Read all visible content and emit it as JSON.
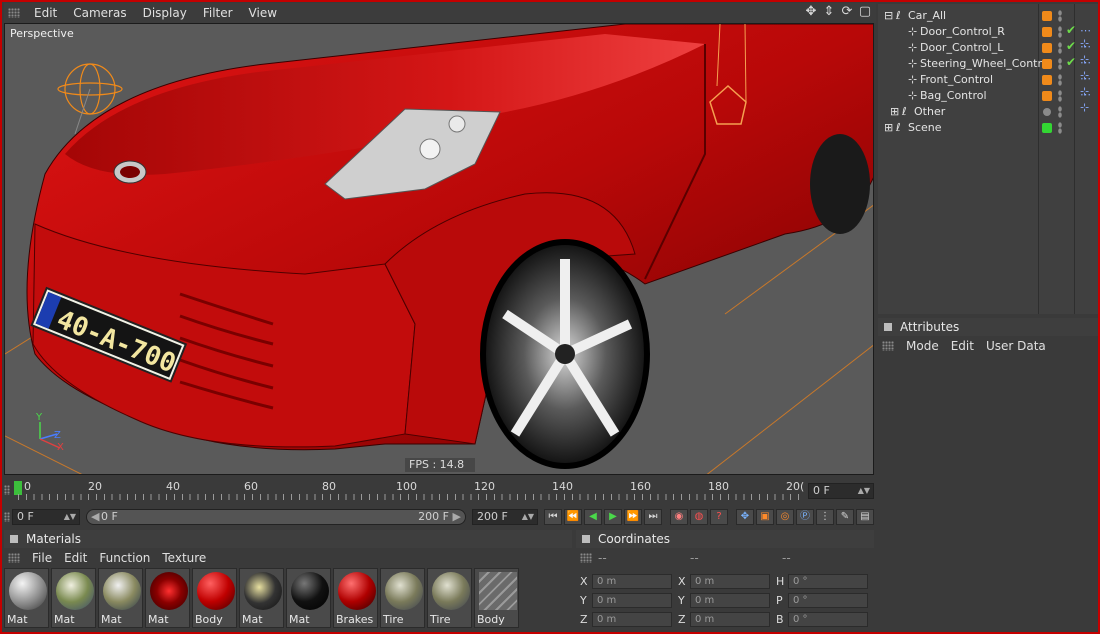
{
  "colors": {
    "accent_red": "#c40000",
    "tag_orange": "#f08a1a",
    "tag_green": "#33d633",
    "car_red": "#c80a0a"
  },
  "viewport": {
    "menu": [
      "Edit",
      "Cameras",
      "Display",
      "Filter",
      "View"
    ],
    "label": "Perspective",
    "fps": "FPS : 14.8",
    "axis_y": "Y",
    "axis_z": "Z",
    "axis_x": "X",
    "plate_text": "40-A-700",
    "plate_small_left": "B\n6",
    "plate_small_right": "3\n7"
  },
  "timeline": {
    "ticks": [
      "0",
      "20",
      "40",
      "60",
      "80",
      "100",
      "120",
      "140",
      "160",
      "180",
      "20("
    ],
    "current_frame": "0 F",
    "start_field": "0 F",
    "range_start": "0 F",
    "range_end": "200 F",
    "end_field": "200 F"
  },
  "materials": {
    "title": "Materials",
    "menu": [
      "File",
      "Edit",
      "Function",
      "Texture"
    ],
    "items": [
      {
        "label": "Mat",
        "style": "grey"
      },
      {
        "label": "Mat",
        "style": "photo"
      },
      {
        "label": "Mat",
        "style": "photo2"
      },
      {
        "label": "Mat",
        "style": "red_swirl"
      },
      {
        "label": "Body",
        "style": "red"
      },
      {
        "label": "Mat",
        "style": "plate"
      },
      {
        "label": "Mat",
        "style": "black"
      },
      {
        "label": "Brakes",
        "style": "red"
      },
      {
        "label": "Tire",
        "style": "metal"
      },
      {
        "label": "Tire",
        "style": "metal"
      },
      {
        "label": "Body",
        "style": "striped"
      }
    ]
  },
  "coordinates": {
    "title": "Coordinates",
    "headers": [
      "--",
      "--",
      "--"
    ],
    "rows": [
      {
        "a_lbl": "X",
        "a_val": "0 m",
        "b_lbl": "X",
        "b_val": "0 m",
        "c_lbl": "H",
        "c_val": "0 °"
      },
      {
        "a_lbl": "Y",
        "a_val": "0 m",
        "b_lbl": "Y",
        "b_val": "0 m",
        "c_lbl": "P",
        "c_val": "0 °"
      },
      {
        "a_lbl": "Z",
        "a_val": "0 m",
        "b_lbl": "Z",
        "b_val": "0 m",
        "c_lbl": "B",
        "c_val": "0 °"
      }
    ]
  },
  "objects": [
    {
      "name": "Car_All",
      "indent": 0,
      "expand": "⊟",
      "tag": "orange",
      "check": false,
      "xp": false
    },
    {
      "name": "Door_Control_R",
      "indent": 2,
      "expand": "",
      "tag": "orange",
      "check": true,
      "xp": true
    },
    {
      "name": "Door_Control_L",
      "indent": 2,
      "expand": "",
      "tag": "orange",
      "check": true,
      "xp": true
    },
    {
      "name": "Steering_Wheel_Control",
      "indent": 2,
      "expand": "",
      "tag": "orange",
      "check": true,
      "xp": true
    },
    {
      "name": "Front_Control",
      "indent": 2,
      "expand": "",
      "tag": "orange",
      "check": false,
      "xp": true
    },
    {
      "name": "Bag_Control",
      "indent": 2,
      "expand": "",
      "tag": "orange",
      "check": false,
      "xp": true
    },
    {
      "name": "Other",
      "indent": 1,
      "expand": "⊞",
      "tag": "grey",
      "check": false,
      "xp": false
    },
    {
      "name": "Scene",
      "indent": 0,
      "expand": "⊞",
      "tag": "green",
      "check": false,
      "xp": false
    }
  ],
  "attributes": {
    "title": "Attributes",
    "menu": [
      "Mode",
      "Edit",
      "User Data"
    ]
  }
}
